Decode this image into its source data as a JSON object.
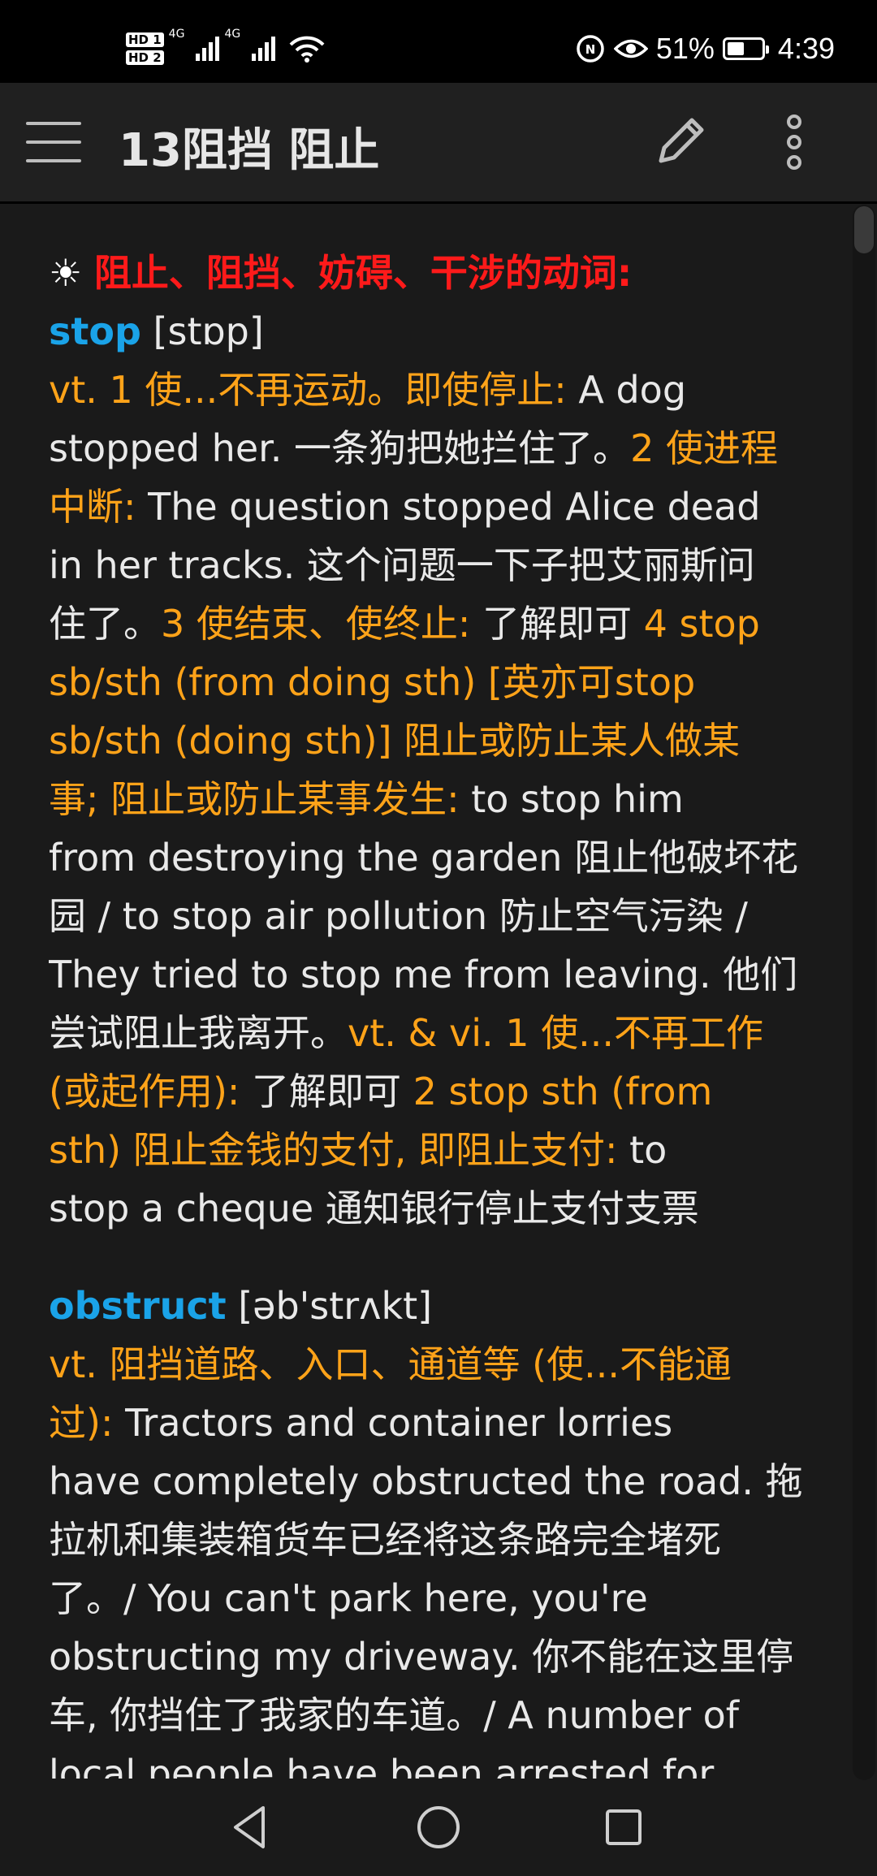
{
  "status_bar": {
    "hd1": "HD 1",
    "hd2": "HD 2",
    "net1": "4G",
    "net2": "4G",
    "battery_pct": "51%",
    "battery_level": 0.51,
    "time": "4:39",
    "icons": [
      "signal-icon",
      "wifi-icon",
      "nfc-icon",
      "eye-icon",
      "battery-icon"
    ]
  },
  "app_bar": {
    "title": "13阻挡 阻止",
    "icons": [
      "menu-icon",
      "edit-pencil-icon",
      "more-vert-icon"
    ]
  },
  "entry": {
    "heading_sym": "☀",
    "heading": "阻止、阻挡、妨碍、干涉的动词:",
    "w1": "stop",
    "w1_ipa": " [stɒp]",
    "w1_lines": [
      [
        [
          "o",
          "vt. 1 使...不再运动。即使停止: "
        ],
        [
          "w",
          "A dog"
        ]
      ],
      [
        [
          "w",
          "stopped her. 一条狗把她拦住了。"
        ],
        [
          "o",
          "2 使进程"
        ]
      ],
      [
        [
          "o",
          "中断: "
        ],
        [
          "w",
          "The question stopped Alice dead"
        ]
      ],
      [
        [
          "w",
          "in her tracks. 这个问题一下子把艾丽斯问"
        ]
      ],
      [
        [
          "w",
          "住了。"
        ],
        [
          "o",
          "3 使结束、使终止: "
        ],
        [
          "w",
          "了解即可 "
        ],
        [
          "o",
          "4 stop"
        ]
      ],
      [
        [
          "o",
          "sb/sth (from doing sth) [英亦可stop"
        ]
      ],
      [
        [
          "o",
          "sb/sth (doing sth)] 阻止或防止某人做某"
        ]
      ],
      [
        [
          "o",
          "事; 阻止或防止某事发生: "
        ],
        [
          "w",
          "to stop him"
        ]
      ],
      [
        [
          "w",
          "from destroying the garden 阻止他破坏花"
        ]
      ],
      [
        [
          "w",
          "园 / to stop air pollution 防止空气污染 /"
        ]
      ],
      [
        [
          "w",
          "They tried to stop me from leaving. 他们"
        ]
      ],
      [
        [
          "w",
          "尝试阻止我离开。"
        ],
        [
          "o",
          "vt. & vi. 1 使...不再工作"
        ]
      ],
      [
        [
          "o",
          "(或起作用): "
        ],
        [
          "w",
          "了解即可 "
        ],
        [
          "o",
          "2 stop sth (from"
        ]
      ],
      [
        [
          "o",
          "sth) 阻止金钱的支付, 即阻止支付: "
        ],
        [
          "w",
          "to"
        ]
      ],
      [
        [
          "w",
          "stop a cheque 通知银行停止支付支票"
        ]
      ]
    ],
    "w2": "obstruct",
    "w2_ipa": " [əb'strʌkt]",
    "w2_lines": [
      [
        [
          "o",
          "vt. 阻挡道路、入口、通道等 (使...不能通"
        ]
      ],
      [
        [
          "o",
          "过): "
        ],
        [
          "w",
          "Tractors and container lorries"
        ]
      ],
      [
        [
          "w",
          "have completely obstructed the road. 拖"
        ]
      ],
      [
        [
          "w",
          "拉机和集装箱货车已经将这条路完全堵死"
        ]
      ],
      [
        [
          "w",
          "了。/ You can't park here, you're"
        ]
      ],
      [
        [
          "w",
          "obstructing my driveway. 你不能在这里停"
        ]
      ],
      [
        [
          "w",
          "车, 你挡住了我家的车道。/ A number of"
        ]
      ],
      [
        [
          "w",
          "local people have been arrested for"
        ]
      ]
    ]
  },
  "nav": {
    "icons": [
      "back-icon",
      "home-icon",
      "recents-icon"
    ]
  }
}
